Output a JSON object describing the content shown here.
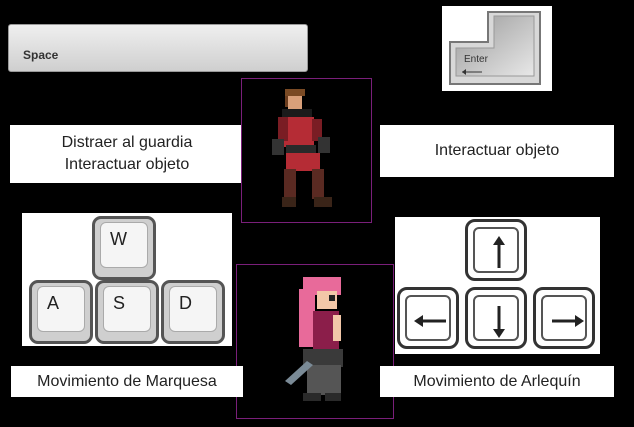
{
  "keys": {
    "space": "Space",
    "enter": "Enter",
    "wasd": [
      "W",
      "A",
      "S",
      "D"
    ]
  },
  "labels": {
    "marquesa_actions": [
      "Distraer al guardia",
      "Interactuar objeto"
    ],
    "arlequin_action": "Interactuar objeto",
    "marquesa_movement": "Movimiento de Marquesa",
    "arlequin_movement": "Movimiento de Arlequín"
  },
  "characters": {
    "frame_color": "#7a1f7a"
  },
  "icons": [
    "arrow-up-icon",
    "arrow-left-icon",
    "arrow-down-icon",
    "arrow-right-icon",
    "enter-return-icon"
  ]
}
